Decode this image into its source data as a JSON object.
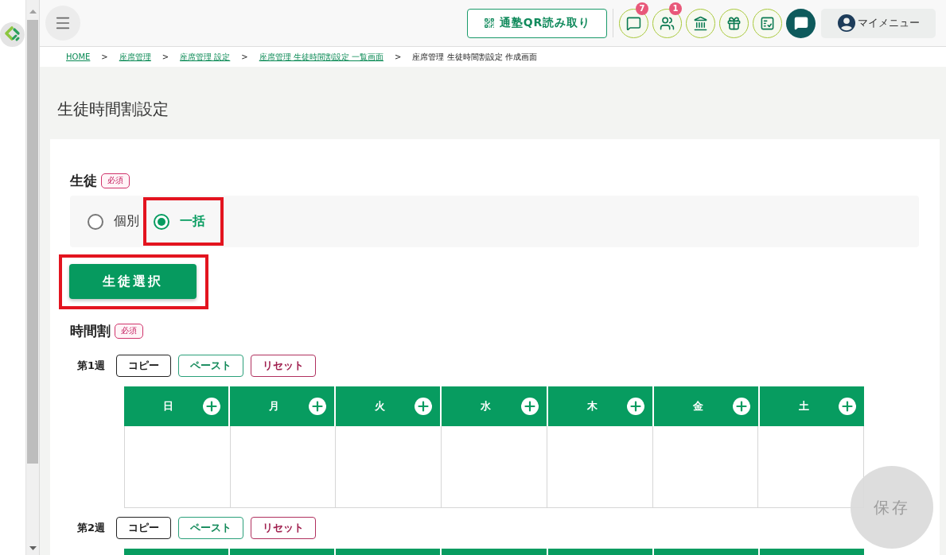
{
  "header": {
    "qr_button": {
      "label": "通塾QR読み取り"
    },
    "icon_buttons": [
      {
        "kind": "chat",
        "badge": "7"
      },
      {
        "kind": "people",
        "badge": "1"
      },
      {
        "kind": "school"
      },
      {
        "kind": "gift"
      },
      {
        "kind": "checklist"
      },
      {
        "kind": "message"
      }
    ],
    "my_menu": {
      "label": "マイメニュー"
    }
  },
  "breadcrumb": [
    {
      "kind": "link",
      "label": "HOME"
    },
    {
      "kind": "separator",
      "label": ">"
    },
    {
      "kind": "link",
      "label": "座席管理"
    },
    {
      "kind": "separator",
      "label": ">"
    },
    {
      "kind": "link",
      "label": "座席管理 設定"
    },
    {
      "kind": "separator",
      "label": ">"
    },
    {
      "kind": "link",
      "label": "座席管理 生徒時間割設定 一覧画面"
    },
    {
      "kind": "separator",
      "label": ">"
    },
    {
      "kind": "current",
      "label": "座席管理 生徒時間割設定 作成画面"
    }
  ],
  "page_title": "生徒時間割設定",
  "student": {
    "label": "生徒",
    "badge": "必須",
    "options": [
      {
        "label": "個別",
        "selected": false,
        "highlighted": false
      },
      {
        "label": "一括",
        "selected": true,
        "highlighted": true
      }
    ],
    "select_button": {
      "label": "生徒選択",
      "highlighted": true
    }
  },
  "timetable": {
    "label": "時間割",
    "badge": "必須",
    "weeks": [
      {
        "label": "第1週",
        "actions": [
          {
            "kind": "copy",
            "label": "コピー"
          },
          {
            "kind": "paste",
            "label": "ペースト"
          },
          {
            "kind": "reset",
            "label": "リセット"
          }
        ],
        "days": [
          {
            "label": "日"
          },
          {
            "label": "月"
          },
          {
            "label": "火"
          },
          {
            "label": "水"
          },
          {
            "label": "木"
          },
          {
            "label": "金"
          },
          {
            "label": "土"
          }
        ]
      },
      {
        "label": "第2週",
        "actions": [
          {
            "kind": "copy",
            "label": "コピー"
          },
          {
            "kind": "paste",
            "label": "ペースト"
          },
          {
            "kind": "reset",
            "label": "リセット"
          }
        ]
      }
    ]
  },
  "save_button": {
    "label": "保存",
    "disabled": true
  }
}
